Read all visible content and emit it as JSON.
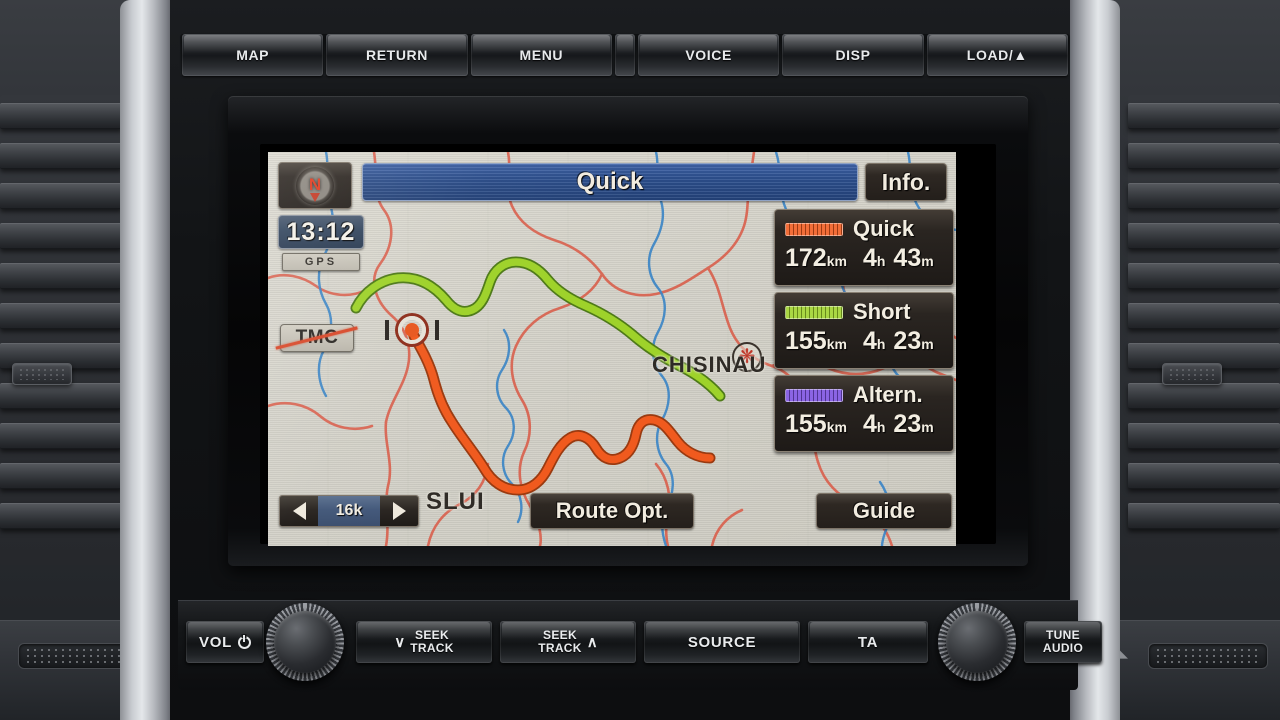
{
  "head_unit": {
    "top_buttons": [
      {
        "name": "map",
        "label": "MAP"
      },
      {
        "name": "return",
        "label": "RETURN"
      },
      {
        "name": "menu",
        "label": "MENU"
      },
      {
        "name": "voice",
        "label": "VOICE"
      },
      {
        "name": "disp",
        "label": "DISP"
      },
      {
        "name": "load",
        "label": "LOAD/▲"
      }
    ],
    "bottom_controls": {
      "vol_label": "VOL",
      "seek_down": {
        "chevron": "∨",
        "line1": "SEEK",
        "line2": "TRACK"
      },
      "seek_up": {
        "chevron": "∧",
        "line1": "SEEK",
        "line2": "TRACK"
      },
      "source_label": "SOURCE",
      "ta_label": "TA",
      "tune_audio": {
        "line1": "TUNE",
        "line2": "AUDIO"
      }
    }
  },
  "screen": {
    "title": "Quick",
    "info_button": "Info.",
    "clock": "13:12",
    "gps_badge": "GPS",
    "tmc_button": "TMC",
    "compass_letter": "N",
    "zoom": {
      "scale": "16k",
      "arrow_left": "left-arrow",
      "arrow_right": "right-arrow"
    },
    "route_opt_button": "Route Opt.",
    "guide_button": "Guide",
    "routes": [
      {
        "name": "Quick",
        "distance": "172",
        "distance_unit": "km",
        "hours": "4",
        "hours_unit": "h",
        "minutes": "43",
        "minutes_unit": "m",
        "color": "#f05a1e"
      },
      {
        "name": "Short",
        "distance": "155",
        "distance_unit": "km",
        "hours": "4",
        "hours_unit": "h",
        "minutes": "23",
        "minutes_unit": "m",
        "color": "#9ed22a"
      },
      {
        "name": "Altern.",
        "distance": "155",
        "distance_unit": "km",
        "hours": "4",
        "hours_unit": "h",
        "minutes": "23",
        "minutes_unit": "m",
        "color": "#7a4fe0"
      }
    ],
    "map_labels": {
      "city_right": "CHISINAU",
      "city_left": "SLUI"
    },
    "colors": {
      "title_bar_blue": "#2d508f",
      "panel_dark": "#241f1b",
      "map_background": "#d7d5cc",
      "road_red": "#d9624f",
      "river_blue": "#3d86c6",
      "route_quick": "#f05a1e",
      "route_short": "#9ed22a",
      "route_altern": "#7a4fe0"
    }
  }
}
